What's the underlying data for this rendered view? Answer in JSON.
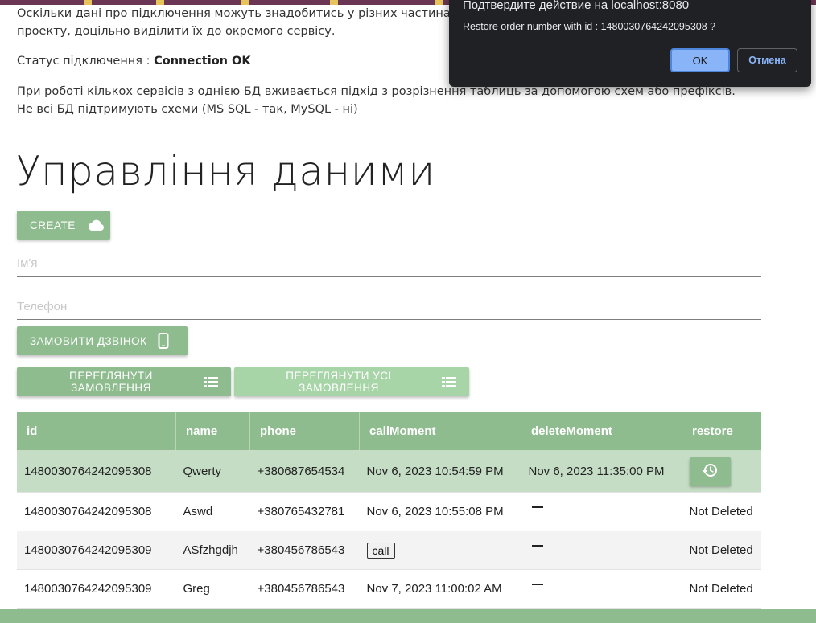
{
  "text": {
    "p1": "Оскільки дані про підключення можуть знадобитись у різних частинах проекту, доцільно виділити їх до окремого сервісу.",
    "status_label": "Статус підключення : ",
    "status_value": "Connection OK",
    "p3": "При роботі кількох сервісів з однією БД вживається підхід з розрізнення таблиць за допомогою схем або префіксів. Не всі БД підтримують схеми (MS SQL - так, MySQL - ні)",
    "heading": "Управління даними"
  },
  "buttons": {
    "create": "CREATE",
    "order_call": "ЗАМОВИТИ ДЗВІНОК",
    "view_orders": "ПЕРЕГЛЯНУТИ ЗАМОВЛЕННЯ",
    "view_all_orders": "ПЕРЕГЛЯНУТИ УСІ ЗАМОВЛЕННЯ"
  },
  "form": {
    "name_placeholder": "Ім'я",
    "phone_placeholder": "Телефон"
  },
  "table": {
    "headers": [
      "id",
      "name",
      "phone",
      "callMoment",
      "deleteMoment",
      "restore"
    ],
    "rows": [
      {
        "id": "1480030764242095308",
        "name": "Qwerty",
        "phone": "+380687654534",
        "callMoment": "Nov 6, 2023 10:54:59 PM",
        "deleteMoment": "Nov 6, 2023 11:35:00 PM",
        "restore": ""
      },
      {
        "id": "1480030764242095308",
        "name": "Aswd",
        "phone": "+380765432781",
        "callMoment": "Nov 6, 2023 10:55:08 PM",
        "deleteMoment": "",
        "restore": "Not Deleted"
      },
      {
        "id": "1480030764242095309",
        "name": "ASfzhgdjh",
        "phone": "+380456786543",
        "callMoment": "",
        "call_label": "call",
        "deleteMoment": "",
        "restore": "Not Deleted"
      },
      {
        "id": "1480030764242095309",
        "name": "Greg",
        "phone": "+380456786543",
        "callMoment": "Nov 7, 2023 11:00:02 AM",
        "deleteMoment": "",
        "restore": "Not Deleted"
      }
    ]
  },
  "dialog": {
    "title": "Подтвердите действие на localhost:8080",
    "message": "Restore order number with id : 1480030764242095308 ?",
    "ok": "OK",
    "cancel": "Отмена"
  },
  "colors": {
    "accent": "#8fbc8f",
    "accent_light": "#a8d5a8",
    "selected_row": "#c5ddc5",
    "topbar": "#6b3654",
    "dialog_bg": "#202124",
    "dialog_button": "#8ab4f8"
  }
}
